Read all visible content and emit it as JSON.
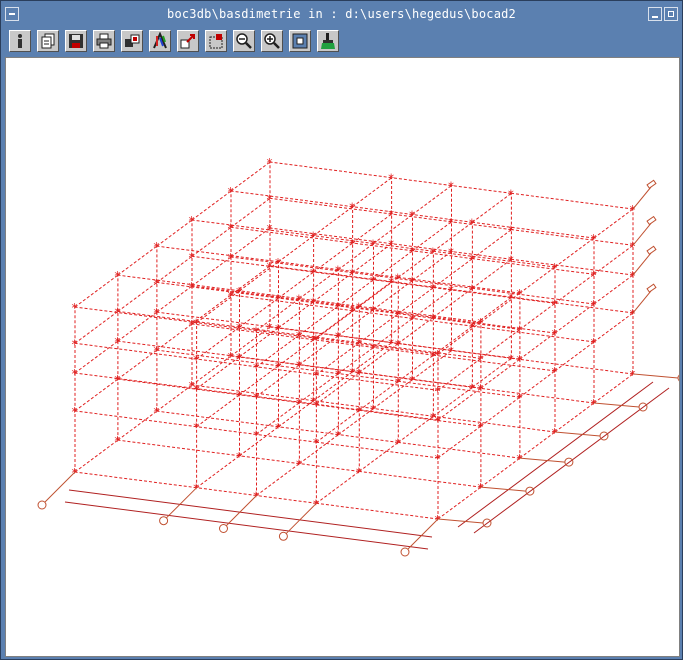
{
  "window": {
    "title": "boc3db\\basdimetrie in : d:\\users\\hegedus\\bocad2"
  },
  "toolbar": {
    "tools": [
      {
        "name": "info-icon"
      },
      {
        "name": "copy-icon"
      },
      {
        "name": "save-icon"
      },
      {
        "name": "print-icon"
      },
      {
        "name": "layers-icon"
      },
      {
        "name": "color-palette-icon"
      },
      {
        "name": "zoom-window-icon"
      },
      {
        "name": "zoom-region-icon"
      },
      {
        "name": "zoom-out-icon"
      },
      {
        "name": "zoom-in-icon"
      },
      {
        "name": "fit-view-icon"
      },
      {
        "name": "clear-brush-icon"
      }
    ]
  },
  "drawing": {
    "line_color": "#e02020",
    "dimension_color": "#b02020",
    "axis_marker_color": "#c05030",
    "background": "#ffffff"
  }
}
